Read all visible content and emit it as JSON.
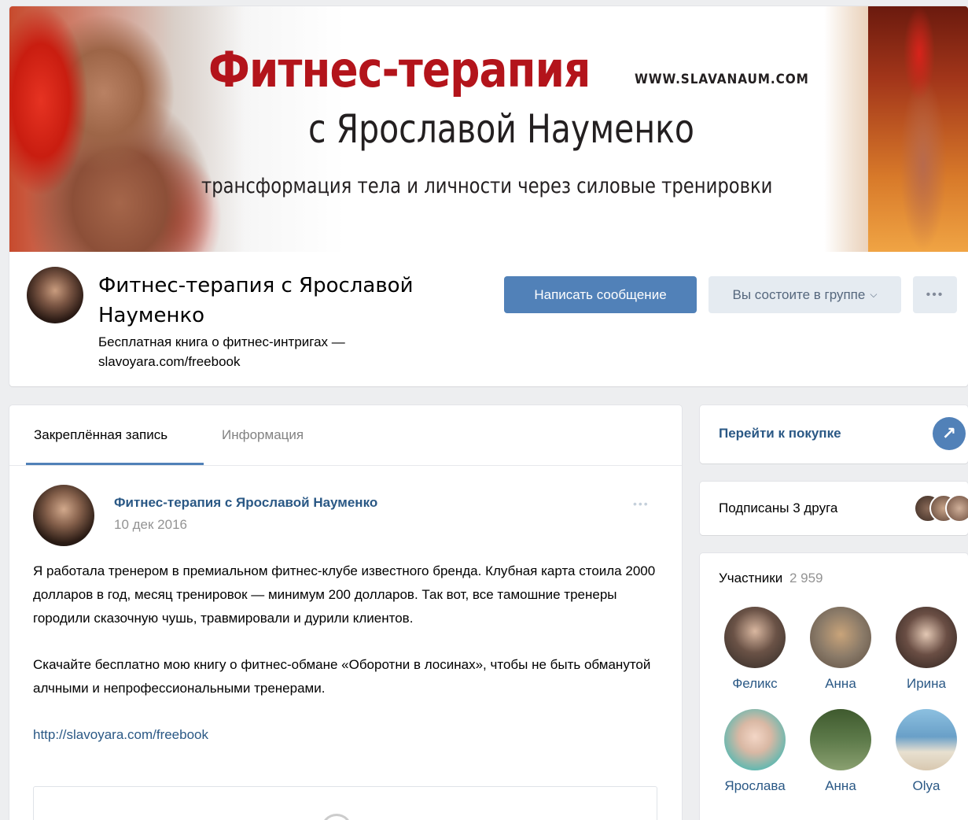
{
  "cover": {
    "title": "Фитнес-терапия",
    "subtitle": "с Ярославой Науменко",
    "url": "WWW.SLAVANAUM.COM",
    "tagline": "трансформация тела и личности через силовые тренировки"
  },
  "group": {
    "name": "Фитнес-терапия с Ярославой Науменко",
    "status": "Бесплатная книга о фитнес-интригах — slavoyara.com/freebook",
    "send_message_label": "Написать сообщение",
    "member_label": "Вы состоите в группе",
    "more_label": "•••"
  },
  "tabs": [
    {
      "label": "Закреплённая запись",
      "active": true
    },
    {
      "label": "Информация",
      "active": false
    }
  ],
  "post": {
    "author": "Фитнес-терапия с Ярославой Науменко",
    "date": "10 дек 2016",
    "more_label": "•••",
    "paragraph1": "Я работала тренером в премиальном фитнес-клубе известного бренда. Клубная карта стоила 2000 долларов в год, месяц тренировок — минимум 200 долларов. Так вот, все тамошние тренеры городили сказочную чушь, травмировали и дурили клиентов.",
    "paragraph2": "Скачайте бесплатно мою книгу о фитнес-обмане «Оборотни в лосинах», чтобы не быть обманутой алчными и непрофессиональными тренерами.",
    "link": "http://slavoyara.com/freebook"
  },
  "sidebar": {
    "buy_label": "Перейти к покупке",
    "buy_icon": "↗",
    "friends_label": "Подписаны 3 друга",
    "members_title": "Участники",
    "members_count": "2 959",
    "members": [
      {
        "name": "Феликс",
        "color": "#3a3530"
      },
      {
        "name": "Анна",
        "color": "#8a7a68"
      },
      {
        "name": "Ирина",
        "color": "#4a3a34"
      },
      {
        "name": "Ярослава",
        "color": "#5fb8b0"
      },
      {
        "name": "Анна",
        "color": "#5d7a4a"
      },
      {
        "name": "Olya",
        "color": "#6aa0c8"
      }
    ]
  },
  "colors": {
    "accent": "#5181b8",
    "link": "#2a5885",
    "cover_title": "#b3141b"
  }
}
